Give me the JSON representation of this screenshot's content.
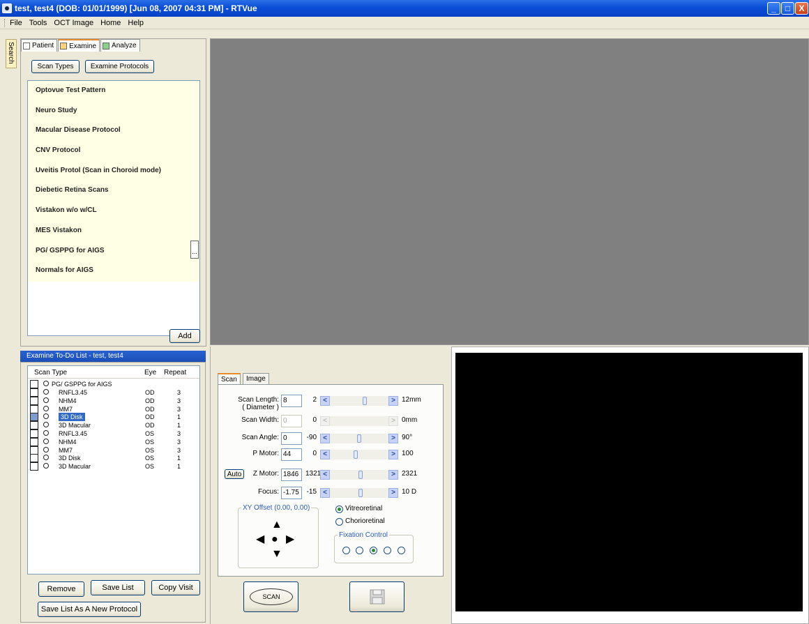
{
  "window": {
    "title": "test, test4  (DOB: 01/01/1999)  [Jun 08, 2007 04:31 PM] - RTVue",
    "min": "_",
    "max": "□",
    "close": "X"
  },
  "menu": [
    "File",
    "Tools",
    "OCT Image",
    "Home",
    "Help"
  ],
  "search_tab": "Search",
  "tabs": [
    "Patient",
    "Examine",
    "Analyze"
  ],
  "buttons": {
    "scan_types": "Scan Types",
    "examine_protocols": "Examine Protocols",
    "add": "Add",
    "more": "..."
  },
  "protocols": [
    "Optovue Test Pattern",
    "Neuro Study",
    "Macular Disease Protocol",
    "CNV Protocol",
    "Uveitis Protol (Scan in Choroid mode)",
    "Diebetic Retina Scans",
    "Vistakon w/o  w/CL",
    "MES Vistakon",
    "PG/ GSPPG for AIGS",
    "Normals for AIGS"
  ],
  "todo": {
    "header": "Examine To-Do List - test, test4",
    "columns": [
      "Scan Type",
      "Eye",
      "Repeat"
    ],
    "group": "PG/ GSPPG for AIGS",
    "rows": [
      {
        "name": "RNFL3.45",
        "eye": "OD",
        "repeat": "3"
      },
      {
        "name": "NHM4",
        "eye": "OD",
        "repeat": "3"
      },
      {
        "name": "MM7",
        "eye": "OD",
        "repeat": "3"
      },
      {
        "name": "3D Disk",
        "eye": "OD",
        "repeat": "1"
      },
      {
        "name": "3D Macular",
        "eye": "OD",
        "repeat": "1"
      },
      {
        "name": "RNFL3.45",
        "eye": "OS",
        "repeat": "3"
      },
      {
        "name": "NHM4",
        "eye": "OS",
        "repeat": "3"
      },
      {
        "name": "MM7",
        "eye": "OS",
        "repeat": "3"
      },
      {
        "name": "3D Disk",
        "eye": "OS",
        "repeat": "1"
      },
      {
        "name": "3D Macular",
        "eye": "OS",
        "repeat": "1"
      }
    ],
    "selected_index": 3,
    "remove": "Remove",
    "save_list": "Save List",
    "copy_visit": "Copy Visit",
    "save_new": "Save List As A New Protocol"
  },
  "scan_tabs": [
    "Scan",
    "Image"
  ],
  "controls": {
    "scan_length": {
      "label": "Scan Length:",
      "sublabel": "( Diameter )",
      "value": "8",
      "min": "2",
      "max": "12mm"
    },
    "scan_width": {
      "label": "Scan Width:",
      "value": "0",
      "min": "0",
      "max": "0mm"
    },
    "scan_angle": {
      "label": "Scan Angle:",
      "value": "0",
      "min": "-90",
      "max": "90°"
    },
    "p_motor": {
      "label": "P Motor:",
      "value": "44",
      "min": "0",
      "max": "100"
    },
    "z_motor": {
      "label": "Z Motor:",
      "value": "1846",
      "min": "1321",
      "max": "2321",
      "auto": "Auto"
    },
    "focus": {
      "label": "Focus:",
      "value": "-1.75",
      "min": "-15",
      "max": "10 D"
    }
  },
  "xy_offset": "XY Offset (0.00, 0.00)",
  "modes": [
    "Vitreoretinal",
    "Chorioretinal"
  ],
  "fixation": "Fixation Control",
  "scan_button": "SCAN"
}
